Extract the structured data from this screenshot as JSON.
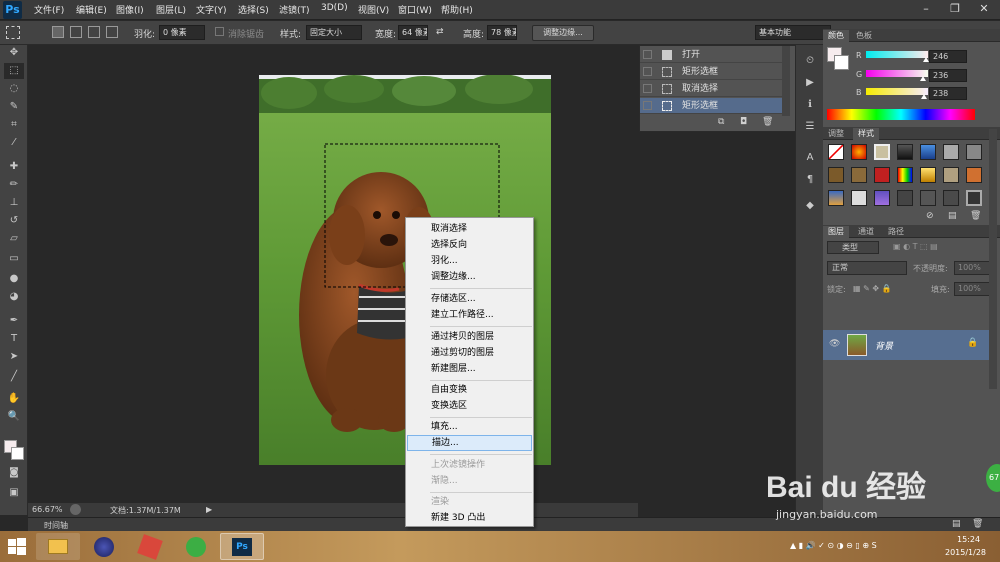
{
  "app": {
    "logo": "Ps"
  },
  "menu": [
    "文件(F)",
    "编辑(E)",
    "图像(I)",
    "图层(L)",
    "文字(Y)",
    "选择(S)",
    "滤镜(T)",
    "3D(D)",
    "视图(V)",
    "窗口(W)",
    "帮助(H)"
  ],
  "window_controls": {
    "minimize": "–",
    "restore": "❐",
    "close": "✕"
  },
  "options": {
    "feather_label": "羽化:",
    "feather_value": "0 像素",
    "antialias_label": "消除锯齿",
    "style_label": "样式:",
    "style_value": "固定大小",
    "width_label": "宽度:",
    "width_value": "64 像素",
    "height_label": "高度:",
    "height_value": "78 像素",
    "refine_edge": "调整边缘...",
    "workspace": "基本功能"
  },
  "status": {
    "zoom": "66.67%",
    "doc": "文档:1.37M/1.37M"
  },
  "timeline_label": "时间轴",
  "history": {
    "items": [
      {
        "label": "打开",
        "selected": false
      },
      {
        "label": "矩形选框",
        "selected": false
      },
      {
        "label": "取消选择",
        "selected": false
      },
      {
        "label": "矩形选框",
        "selected": true
      }
    ]
  },
  "color_panel": {
    "tabs": [
      "颜色",
      "色板"
    ],
    "r_label": "R",
    "r_value": "246",
    "g_label": "G",
    "g_value": "236",
    "b_label": "B",
    "b_value": "238",
    "slider_r": 0.965,
    "slider_g": 0.925,
    "slider_b": 0.933,
    "foreground": "#f6ecee"
  },
  "styles_panel": {
    "tabs": [
      "调整",
      "样式"
    ]
  },
  "layers_panel": {
    "tabs": [
      "图层",
      "通道",
      "路径"
    ],
    "filter_label": "类型",
    "blend_mode": "正常",
    "opacity_label": "不透明度:",
    "opacity_value": "100%",
    "lock_label": "锁定:",
    "fill_label": "填充:",
    "fill_value": "100%",
    "layer_name": "背景"
  },
  "context_menu": {
    "items": [
      {
        "label": "取消选择",
        "disabled": false
      },
      {
        "label": "选择反向",
        "disabled": false
      },
      {
        "label": "羽化...",
        "disabled": false
      },
      {
        "label": "调整边缘...",
        "disabled": false
      },
      {
        "label": "存储选区...",
        "disabled": false
      },
      {
        "label": "建立工作路径...",
        "disabled": false
      },
      {
        "label": "通过拷贝的图层",
        "disabled": false
      },
      {
        "label": "通过剪切的图层",
        "disabled": false
      },
      {
        "label": "新建图层...",
        "disabled": false
      },
      {
        "label": "自由变换",
        "disabled": false
      },
      {
        "label": "变换选区",
        "disabled": false
      },
      {
        "label": "填充...",
        "disabled": false
      },
      {
        "label": "描边...",
        "disabled": false,
        "highlighted": true
      },
      {
        "label": "上次滤镜操作",
        "disabled": true
      },
      {
        "label": "渐隐...",
        "disabled": true
      },
      {
        "label": "渲染",
        "disabled": true
      },
      {
        "label": "新建 3D 凸出",
        "disabled": false
      }
    ]
  },
  "taskbar": {
    "time": "15:24",
    "date": "2015/1/28"
  },
  "watermark": {
    "brand": "Bai du 经验",
    "url": "jingyan.baidu.com",
    "badge": "67"
  },
  "colors": {
    "highlight_row": "#556b8c",
    "ps_blue": "#31a8ff"
  }
}
